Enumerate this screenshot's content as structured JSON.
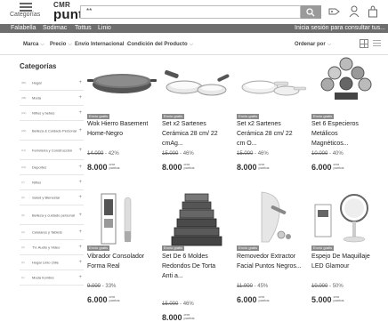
{
  "header": {
    "menu_label": "Categorías",
    "logo_top": "CMR",
    "logo_main": "puntos",
    "search_value": "**"
  },
  "nav": {
    "links": [
      "Falabella",
      "Sodimac",
      "Tottus",
      "Linio"
    ],
    "right_text": "Inicia sesión para consultar tus..."
  },
  "filters": {
    "items": [
      "Marca",
      "Precio",
      "Envío Internacional",
      "Condición del Producto"
    ],
    "order_label": "Ordenar por"
  },
  "sidebar": {
    "title": "Categorías",
    "items": [
      {
        "label": "Hogar"
      },
      {
        "label": "Moda"
      },
      {
        "label": "Niños y bebés"
      },
      {
        "label": "Belleza & Cuidado Personal"
      },
      {
        "label": "Ferretería y Construcción"
      },
      {
        "label": "Deportes"
      },
      {
        "label": "Niños"
      },
      {
        "label": "Salud y Bienestar"
      },
      {
        "label": "Belleza y cuidado personal"
      },
      {
        "label": "Celulares y Tablets"
      },
      {
        "label": "TV, Audio y Video"
      },
      {
        "label": "Hogar Linio chile"
      },
      {
        "label": "Moda hombre"
      }
    ]
  },
  "products": [
    {
      "badge": "Envío gratis",
      "title_line1": "Wok Hierro Basement",
      "title_line2": "Home-Negro",
      "title_line3": "",
      "old_price": "14.000",
      "discount": "- 42%",
      "points": "8.000",
      "unit_line1": "cmr",
      "unit_line2": "puntos"
    },
    {
      "badge": "Envío gratis",
      "title_line1": "Set x2 Sartenes",
      "title_line2": "Cerámica 28 cm/ 22",
      "title_line3": "cmAg...",
      "old_price": "15.000",
      "discount": "- 46%",
      "points": "8.000",
      "unit_line1": "cmr",
      "unit_line2": "puntos"
    },
    {
      "badge": "Envío gratis",
      "title_line1": "Set x2 Sartenes",
      "title_line2": "Cerámica 28 cm/ 22",
      "title_line3": "cm O...",
      "old_price": "15.000",
      "discount": "- 46%",
      "points": "8.000",
      "unit_line1": "cmr",
      "unit_line2": "puntos"
    },
    {
      "badge": "Envío gratis",
      "title_line1": "Set 6 Especieros",
      "title_line2": "Metálicos",
      "title_line3": "Magnéticos...",
      "old_price": "10.000",
      "discount": "- 40%",
      "points": "6.000",
      "unit_line1": "cmr",
      "unit_line2": "puntos"
    },
    {
      "badge": "Envío gratis",
      "title_line1": "Vibrador Consolador",
      "title_line2": "Forma Real",
      "title_line3": "",
      "old_price": "9.000",
      "discount": "- 33%",
      "points": "6.000",
      "unit_line1": "cmr",
      "unit_line2": "puntos"
    },
    {
      "badge": "Envío gratis",
      "title_line1": "Set De 6 Moldes",
      "title_line2": "Redondos De Torta",
      "title_line3": "Anti a...",
      "old_price": "15.000",
      "discount": "- 46%",
      "points": "8.000",
      "unit_line1": "cmr",
      "unit_line2": "puntos"
    },
    {
      "badge": "Envío gratis",
      "title_line1": "Removedor Extractor",
      "title_line2": "Facial Puntos Negros...",
      "title_line3": "",
      "old_price": "11.000",
      "discount": "- 45%",
      "points": "6.000",
      "unit_line1": "cmr",
      "unit_line2": "puntos"
    },
    {
      "badge": "Envío gratis",
      "title_line1": "Espejo De Maquillaje",
      "title_line2": "LED Glamour",
      "title_line3": "",
      "old_price": "10.000",
      "discount": "- 50%",
      "points": "5.000",
      "unit_line1": "cmr",
      "unit_line2": "puntos"
    }
  ]
}
